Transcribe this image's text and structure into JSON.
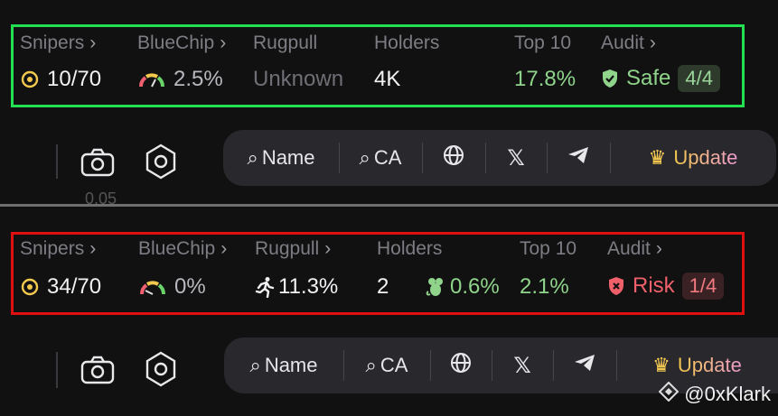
{
  "colors": {
    "safe_frame": "#22e04f",
    "risk_frame": "#e01010",
    "accent_yellow": "#f2c94c",
    "green_text": "#8fd48a",
    "red_text": "#f0606a"
  },
  "panel_top": {
    "labels": {
      "snipers": "Snipers",
      "bluechip": "BlueChip",
      "rugpull": "Rugpull",
      "holders": "Holders",
      "top10": "Top 10",
      "audit": "Audit"
    },
    "values": {
      "snipers": "10/70",
      "bluechip": "2.5%",
      "rugpull": "Unknown",
      "holders": "4K",
      "top10": "17.8%",
      "audit": "Safe",
      "audit_score": "4/4"
    },
    "stub_text": "0.05"
  },
  "panel_bottom": {
    "labels": {
      "snipers": "Snipers",
      "bluechip": "BlueChip",
      "rugpull": "Rugpull",
      "holders": "Holders",
      "top10": "Top 10",
      "audit": "Audit"
    },
    "values": {
      "snipers": "34/70",
      "bluechip": "0%",
      "rugpull": "11.3%",
      "holders": "2",
      "holders_extra": "0.6%",
      "top10": "2.1%",
      "audit": "Risk",
      "audit_score": "1/4"
    }
  },
  "toolbar": {
    "name": "Name",
    "ca": "CA",
    "update": "Update"
  },
  "watermark": "@0xKlark"
}
